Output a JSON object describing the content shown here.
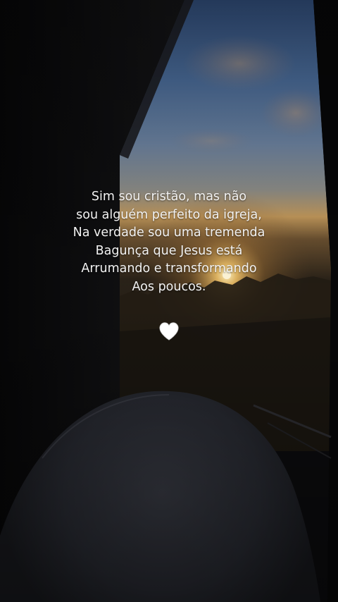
{
  "quote": {
    "lines": [
      "Sim sou cristão, mas não",
      "sou alguém perfeito da igreja,",
      "Na verdade sou uma tremenda",
      "Bagunça que Jesus está",
      "Arrumando e transformando",
      "Aos poucos."
    ]
  },
  "icons": {
    "heart": "white-heart-icon"
  },
  "colors": {
    "text": "#f2f2f2",
    "heart": "#ffffff",
    "sky_top": "#3c5a86",
    "sunset_glow": "#f0c060",
    "dark_frame": "#0b0b0d"
  }
}
